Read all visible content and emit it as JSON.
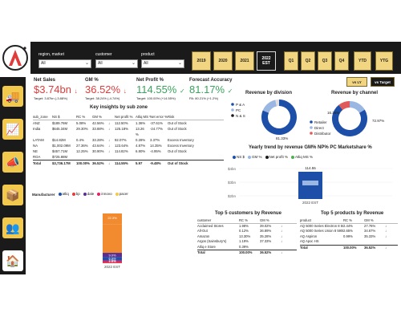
{
  "slicers": [
    {
      "label": "region, market",
      "value": "All"
    },
    {
      "label": "customer",
      "value": "All"
    },
    {
      "label": "product",
      "value": "All"
    }
  ],
  "years": [
    "2019",
    "2020",
    "2021",
    "2022 EST"
  ],
  "quarters": [
    "Q1",
    "Q2",
    "Q3",
    "Q4"
  ],
  "periods": [
    "YTD",
    "YTG"
  ],
  "compare": {
    "vs_ly": "vs LY",
    "vs_target": "vs Target"
  },
  "kpis": [
    {
      "title": "Net Sales",
      "value": "$3.74bn",
      "sub": "Target: 3.87bn (-3.88%)",
      "color": "#e03c3c",
      "arrow": "↓"
    },
    {
      "title": "GM %",
      "value": "36.52%",
      "sub": "Target: 38.24% (-4.74%)",
      "color": "#e03c3c",
      "arrow": "↓"
    },
    {
      "title": "Net Profit %",
      "value": "114.55%",
      "sub": "Target: 100.00% (+14.55%)",
      "color": "#3aa35c",
      "arrow": "✓"
    },
    {
      "title": "Forecast Accuracy",
      "value": "81.17%",
      "sub": "PA: 80.21% (+1.2%)",
      "color": "#3aa35c",
      "arrow": "✓"
    }
  ],
  "subzone": {
    "title": "Key insights by sub zone",
    "headers": [
      "sub_zone",
      "NS $",
      "RC %",
      "GM %",
      "",
      "Net profit %",
      "Atliq MS %",
      "Net error %",
      "Risk"
    ],
    "rows": [
      [
        "ANZ",
        "$189.76M",
        "5.08%",
        "42.56%",
        "↓",
        "112.50%",
        "1.36%",
        "-37.61%",
        "Out of Stock"
      ],
      [
        "India",
        "$645.34M",
        "29.30%",
        "33.88%",
        "↓",
        "125.18%",
        "13.26",
        "-24.77%",
        "Out of Stock"
      ],
      [
        "",
        "",
        "",
        "",
        "",
        "",
        "%",
        "",
        ""
      ],
      [
        "LATAM",
        "$14.82M",
        "0.4%",
        "33.28%",
        "↓",
        "92.07%",
        "0.28%",
        "3.37%",
        "Excess Inventory"
      ],
      [
        "NA",
        "$1,002.09M",
        "27.36%",
        "43.64%",
        "↓",
        "123.64%",
        "4.87%",
        "14.35%",
        "Excess Inventory"
      ],
      [
        "NE",
        "$457.71M",
        "12.25%",
        "30.90%",
        "↓",
        "114.82%",
        "6.80%",
        "-4.95%",
        "Out of Stock"
      ],
      [
        "ROA",
        "$725.88M",
        "",
        "",
        "",
        "",
        "",
        "",
        ""
      ]
    ],
    "total": [
      "Total",
      "$3,736.17M",
      "100.00%",
      "36.52%",
      "↓",
      "114.55%",
      "5.97",
      "-9.48%",
      "Out of Stock"
    ]
  },
  "division": {
    "title": "Revenue by division",
    "labels": [
      "P & A",
      "PC",
      "N & S"
    ],
    "values": [
      81.33,
      15.2,
      3.47
    ],
    "pct_label": "81.33%"
  },
  "channel": {
    "title": "Revenue by channel",
    "labels": [
      "Retailer",
      "Direct",
      "Distributor"
    ],
    "values": [
      72.97,
      16.36,
      10.67
    ],
    "pct_labels": [
      "16.36%",
      "72.97%"
    ]
  },
  "trend": {
    "title": "Yearly trend by revenue GM% NP% PC Marketshare %",
    "legend": [
      "NS $",
      "GM %",
      "Net profit %",
      "Atliq MS %"
    ],
    "legend_colors": [
      "#1e4fa8",
      "#9ab6e2",
      "#1a1a1a",
      "#4caf50"
    ],
    "axis": [
      "$4bn",
      "$3bn",
      "$2bn"
    ],
    "bar_label": "114.55",
    "year_label": "2022 EST"
  },
  "manufacturer": {
    "title": "Manufacturer",
    "legend": [
      "atliq",
      "bp",
      "dale",
      "innovo",
      "pacer"
    ],
    "colors": [
      "#1e4fa8",
      "#e03c3c",
      "#5a2d91",
      "#e91e63",
      "#f2c94c"
    ],
    "segments": [
      {
        "label": "22.3%",
        "value": 22.3,
        "color": "#f28b30"
      },
      {
        "label": "",
        "value": 56.8,
        "color": "#f28b30"
      },
      {
        "label": "9.0%",
        "value": 9.0,
        "color": "#5a2d91"
      },
      {
        "label": "6.9%",
        "value": 6.9,
        "color": "#1e4fa8"
      },
      {
        "label": "3.5%",
        "value": 3.5,
        "color": "#e91e63"
      },
      {
        "label": "1.5%",
        "value": 1.5,
        "color": "#e03c3c"
      }
    ],
    "year_label": "2022 EST"
  },
  "customers": {
    "title": "Top 5 customers by Revenue",
    "headers": [
      "customer",
      "RC %",
      "GM %"
    ],
    "rows": [
      [
        "Acclaimed Stores",
        "1.98%",
        "39.02%",
        "↓"
      ],
      [
        "All-Out",
        "0.12%",
        "36.89%",
        "↓"
      ],
      [
        "Amazon",
        "13.30%",
        "35.28%",
        "↓"
      ],
      [
        "Argos (Sainsbury's)",
        "1.19%",
        "37.33%",
        "↓"
      ],
      [
        "Atliq e Store",
        "0.39%",
        "",
        ""
      ]
    ],
    "total": [
      "Total",
      "100.00%",
      "36.52%",
      "↓"
    ]
  },
  "products": {
    "title": "Top 5 products by Revenue",
    "headers": [
      "product",
      "RC %",
      "GM %"
    ],
    "rows": [
      [
        "AQ 5000 Series Electron 8 5900X Desktop Processor",
        "2.44%",
        "27.76%",
        "↓"
      ],
      [
        "AQ 5000 Series Union 8 5900X Desktop Processor",
        "2.65%",
        "34.67%",
        "↓"
      ],
      [
        "AQ Aspiron",
        "0.99%",
        "35.33%",
        "↓"
      ],
      [
        "AQ Apoc HS",
        "",
        "",
        ""
      ]
    ],
    "total": [
      "Total",
      "100.00%",
      "36.52%",
      "↓"
    ]
  },
  "nav_icons": [
    "truck-icon",
    "chart-icon",
    "megaphone-icon",
    "boxes-icon",
    "people-icon",
    "home-icon"
  ]
}
